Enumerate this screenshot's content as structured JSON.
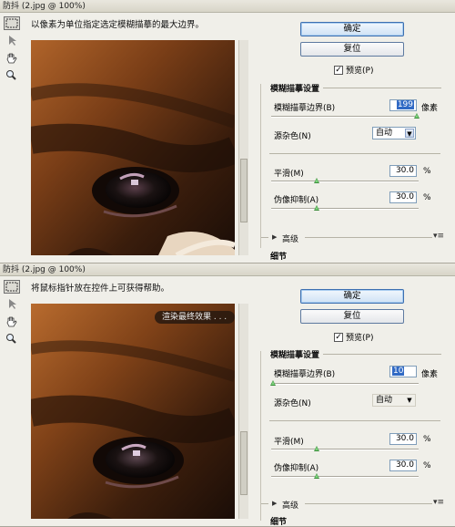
{
  "panels": [
    {
      "title": "防抖 (2.jpg @ 100%)",
      "info_text": "以像素为单位指定选定模糊描摹的最大边界。",
      "ok_label": "确定",
      "reset_label": "复位",
      "preview_label": "预览(P)",
      "preview_checked": true,
      "group_title": "模糊描摹设置",
      "blur_trace_bounds_label": "模糊描摹边界(B)",
      "blur_trace_bounds_value": "199",
      "blur_trace_bounds_unit": "像素",
      "source_noise_label": "源杂色(N)",
      "source_noise_value": "自动",
      "smoothing_label": "平滑(M)",
      "smoothing_value": "30.0",
      "smoothing_unit": "%",
      "artifact_label": "伪像抑制(A)",
      "artifact_value": "30.0",
      "artifact_unit": "%",
      "advanced_label": "高级",
      "detail_label": "细节"
    },
    {
      "title": "防抖 (2.jpg @ 100%)",
      "info_text": "将鼠标指针放在控件上可获得帮助。",
      "overlay_text": "渲染最终效果 . . .",
      "ok_label": "确定",
      "reset_label": "复位",
      "preview_label": "预览(P)",
      "preview_checked": true,
      "group_title": "模糊描摹设置",
      "blur_trace_bounds_label": "模糊描摹边界(B)",
      "blur_trace_bounds_value": "10",
      "blur_trace_bounds_unit": "像素",
      "source_noise_label": "源杂色(N)",
      "source_noise_value": "自动",
      "smoothing_label": "平滑(M)",
      "smoothing_value": "30.0",
      "smoothing_unit": "%",
      "artifact_label": "伪像抑制(A)",
      "artifact_value": "30.0",
      "artifact_unit": "%",
      "advanced_label": "高级",
      "detail_label": "细节"
    }
  ],
  "icons": {
    "marquee": "marquee-tool-icon",
    "arrow": "blur-trace-tool-icon",
    "hand": "hand-tool-icon",
    "zoom": "zoom-tool-icon"
  },
  "colors": {
    "accent": "#316ac5",
    "slider_thumb": "#3a8d3a",
    "primary_button_border": "#3d6fb0"
  }
}
